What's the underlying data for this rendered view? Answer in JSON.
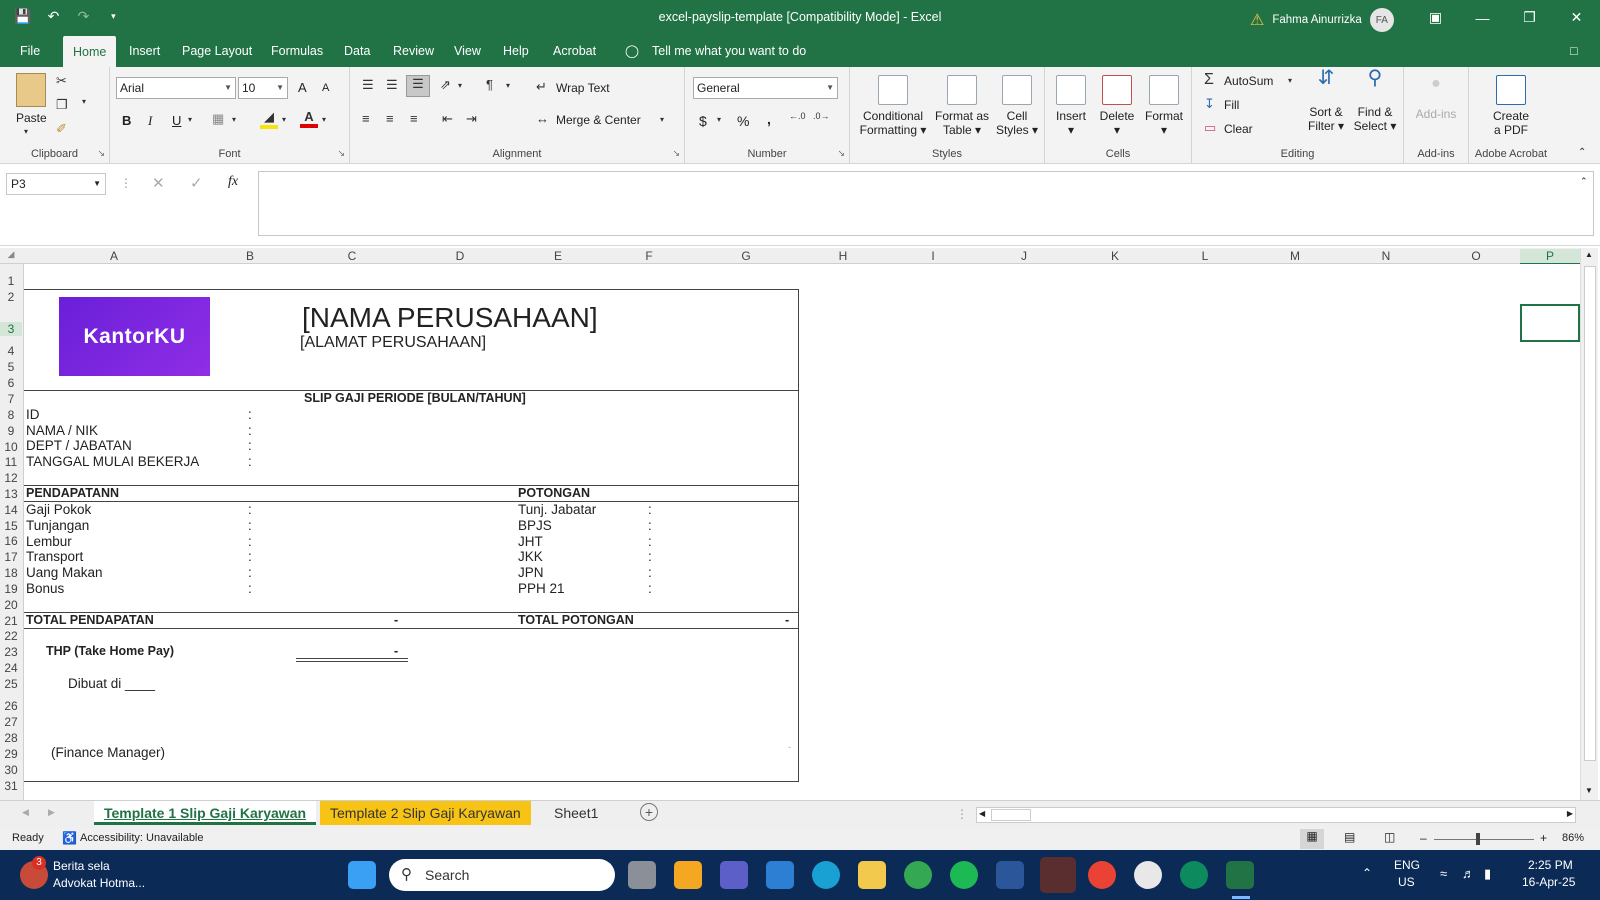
{
  "window": {
    "title": "excel-payslip-template  [Compatibility Mode]  -  Excel",
    "user": "Fahma Ainurrizka",
    "avatar": "FA"
  },
  "menu": [
    "File",
    "Home",
    "Insert",
    "Page Layout",
    "Formulas",
    "Data",
    "Review",
    "View",
    "Help",
    "Acrobat"
  ],
  "tell_me": "Tell me what you want to do",
  "ribbon": {
    "clipboard": {
      "paste": "Paste",
      "label": "Clipboard"
    },
    "font": {
      "name": "Arial",
      "size": "10",
      "label": "Font",
      "bold": "B",
      "italic": "I",
      "underline": "U",
      "grow": "A",
      "shrink": "A"
    },
    "alignment": {
      "wrap": "Wrap Text",
      "merge": "Merge & Center",
      "label": "Alignment"
    },
    "number": {
      "format": "General",
      "label": "Number",
      "currency": "$",
      "percent": "%",
      "comma": ","
    },
    "styles": {
      "cond": [
        "Conditional",
        "Formatting"
      ],
      "table": [
        "Format as",
        "Table"
      ],
      "cell": [
        "Cell",
        "Styles"
      ],
      "label": "Styles"
    },
    "cells": {
      "insert": "Insert",
      "delete": "Delete",
      "format": "Format",
      "label": "Cells"
    },
    "editing": {
      "autosum": "AutoSum",
      "fill": "Fill",
      "clear": "Clear",
      "sort": [
        "Sort &",
        "Filter"
      ],
      "find": [
        "Find &",
        "Select"
      ],
      "label": "Editing"
    },
    "addins": {
      "btn": "Add-ins",
      "label": "Add-ins"
    },
    "acrobat": {
      "btn": [
        "Create",
        "a PDF"
      ],
      "label": "Adobe Acrobat"
    }
  },
  "formula": {
    "namebox": "P3",
    "fx": "fx",
    "value": ""
  },
  "columns": [
    "A",
    "B",
    "C",
    "D",
    "E",
    "F",
    "G",
    "H",
    "I",
    "J",
    "K",
    "L",
    "M",
    "N",
    "O",
    "P"
  ],
  "rows": [
    "1",
    "2",
    "3",
    "4",
    "5",
    "6",
    "7",
    "8",
    "9",
    "10",
    "11",
    "12",
    "13",
    "14",
    "15",
    "16",
    "17",
    "18",
    "19",
    "20",
    "21",
    "22",
    "23",
    "24",
    "25",
    "26",
    "27",
    "28",
    "29",
    "30",
    "31"
  ],
  "slip": {
    "logo": "KantorKU",
    "company": "[NAMA PERUSAHAAN]",
    "address": "[ALAMAT PERUSAHAAN]",
    "period": "SLIP GAJI PERIODE [BULAN/TAHUN]",
    "info": [
      "ID",
      "NAMA / NIK",
      "DEPT / JABATAN",
      "TANGGAL MULAI BEKERJA"
    ],
    "colon": ":",
    "income_head": "PENDAPATANN",
    "deduct_head": "POTONGAN",
    "income": [
      "Gaji Pokok",
      "Tunjangan",
      "Lembur",
      "Transport",
      "Uang Makan",
      "Bonus"
    ],
    "deduct": [
      "Tunj. Jabatar",
      "BPJS",
      "JHT",
      "JKK",
      "JPN",
      "PPH 21"
    ],
    "total_income": "TOTAL PENDAPATAN",
    "total_deduct": "TOTAL POTONGAN",
    "dash": "-",
    "thp": "THP (Take Home Pay)",
    "made_at": "Dibuat di ____",
    "finance": "(Finance Manager)"
  },
  "sheet_tabs": [
    "Template 1 Slip Gaji Karyawan",
    "Template 2 Slip Gaji Karyawan",
    "Sheet1"
  ],
  "status": {
    "ready": "Ready",
    "accessibility": "Accessibility: Unavailable",
    "zoom": "86%"
  },
  "taskbar": {
    "news_badge": "3",
    "news1": "Berita sela",
    "news2": "Advokat Hotma...",
    "search": "Search",
    "lang1": "ENG",
    "lang2": "US",
    "time": "2:25 PM",
    "date": "16-Apr-25"
  }
}
